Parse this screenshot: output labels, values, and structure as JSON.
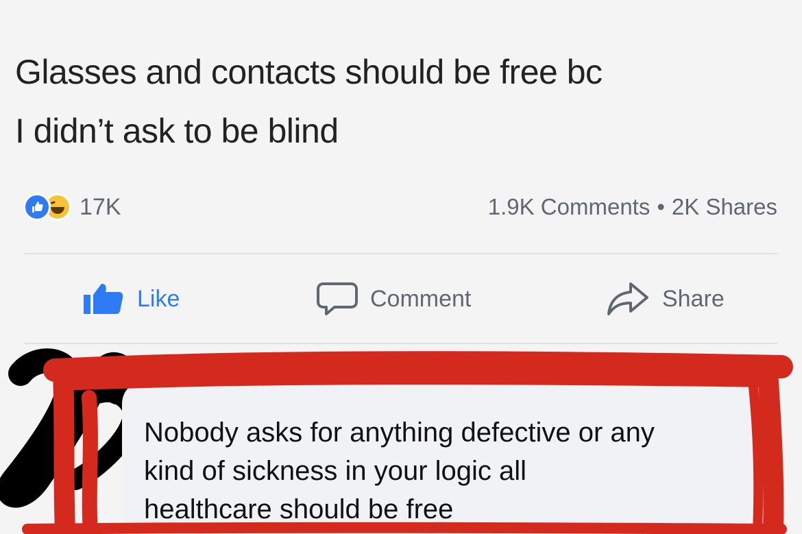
{
  "post": {
    "text_line1": "Glasses and contacts should be free bc",
    "text_line2": "I didn’t ask to be blind"
  },
  "reactions": {
    "icons": [
      "like-reaction-icon",
      "haha-reaction-icon"
    ],
    "count": "17K"
  },
  "stats": {
    "comments": "1.9K Comments",
    "separator": "•",
    "shares": "2K Shares"
  },
  "actions": {
    "like": "Like",
    "comment": "Comment",
    "share": "Share"
  },
  "comment": {
    "line1": "Nobody asks for anything defective or any",
    "line2": "kind of sickness in your logic all",
    "line3": "healthcare should be free"
  },
  "colors": {
    "like_blue": "#2d7cf6",
    "haha_yellow": "#f7c33b",
    "highlight_red": "#d42a1e",
    "redaction_black": "#000000"
  }
}
